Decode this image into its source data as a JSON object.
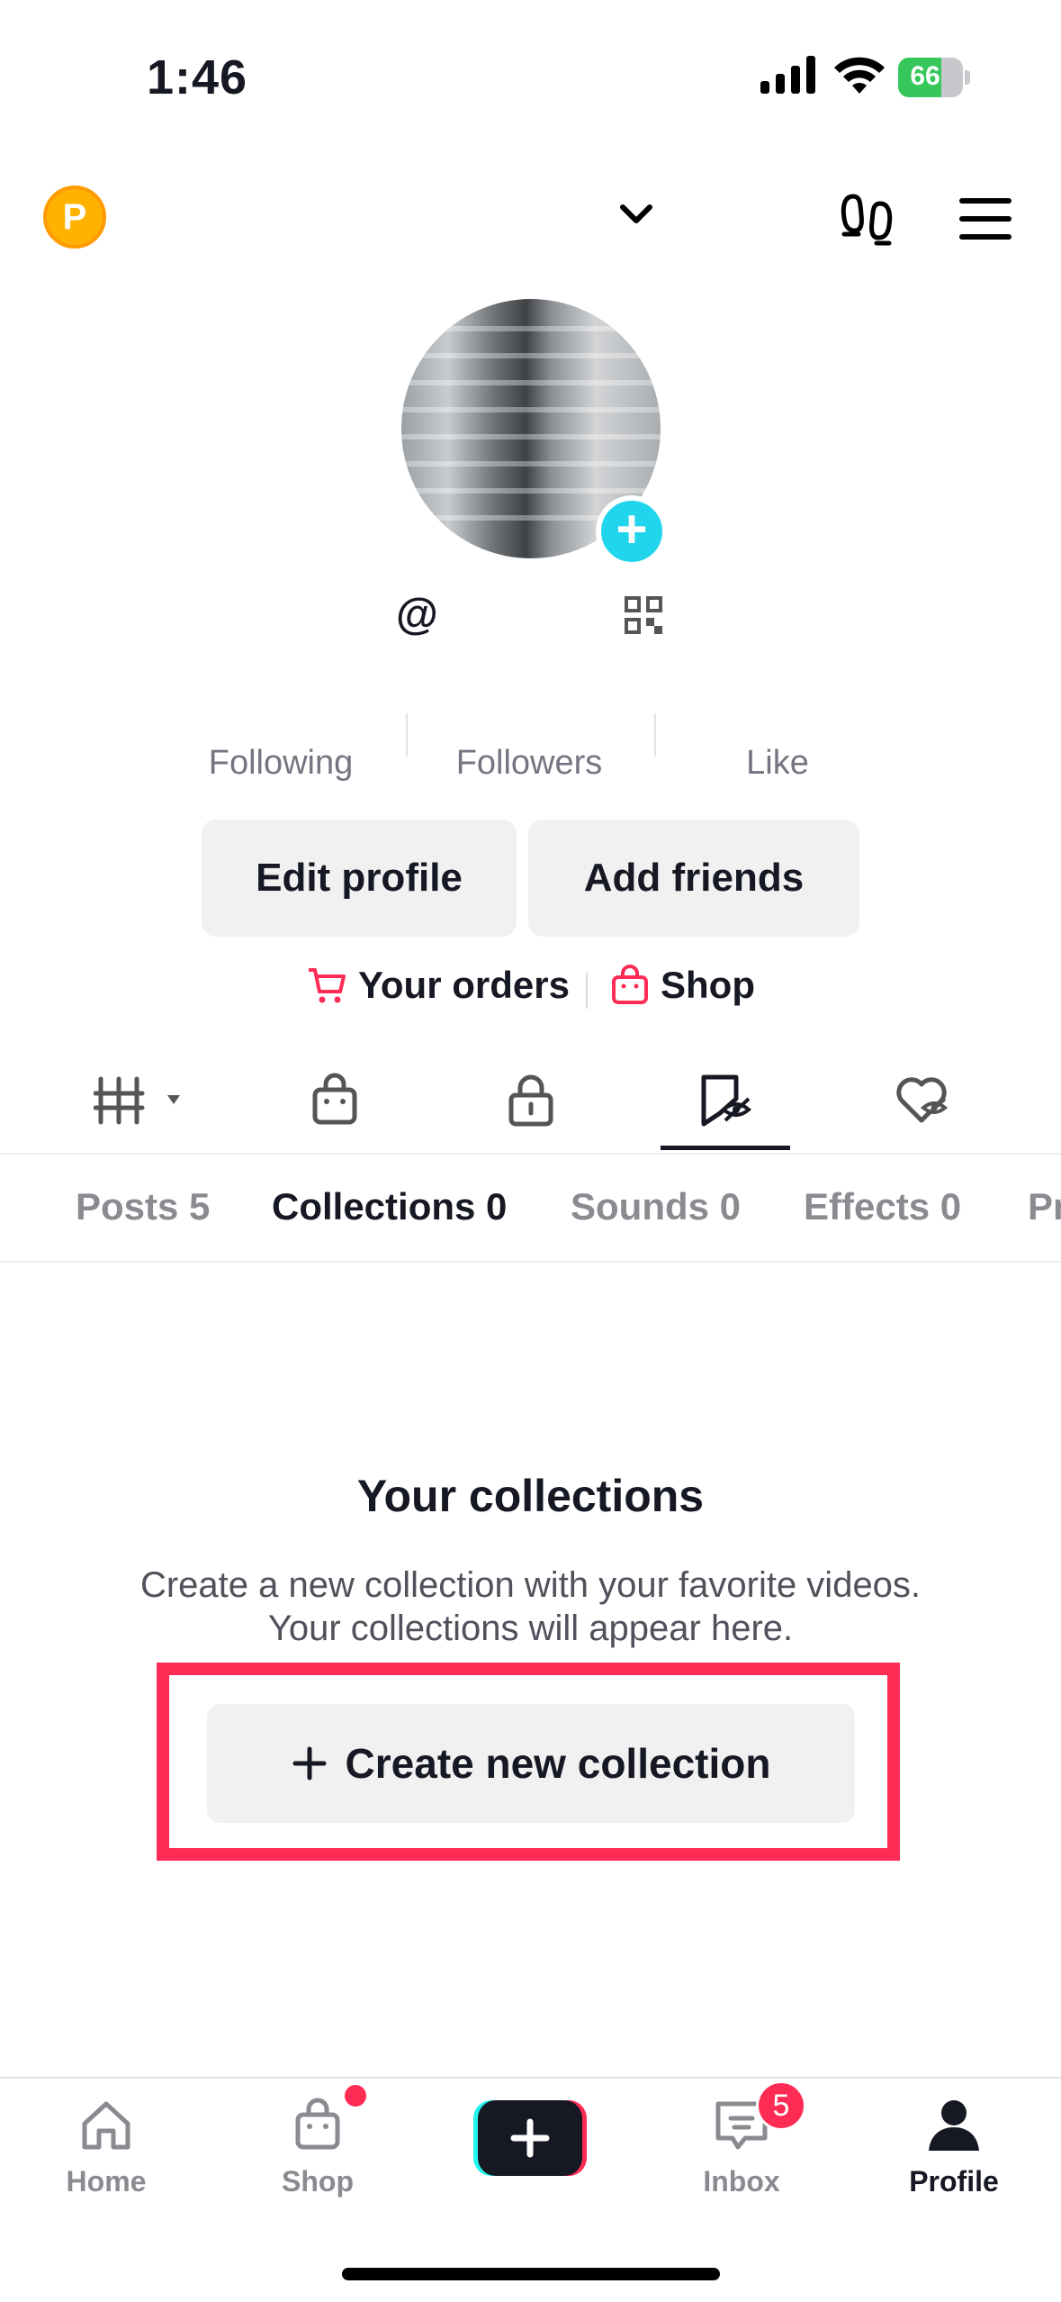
{
  "status_bar": {
    "time": "1:46",
    "battery_level": "66"
  },
  "profile": {
    "at_prefix": "@",
    "stats": [
      {
        "label": "Following"
      },
      {
        "label": "Followers"
      },
      {
        "label": "Like"
      }
    ],
    "edit_profile_label": "Edit profile",
    "add_friends_label": "Add friends",
    "orders_label": "Your orders",
    "shop_label": "Shop"
  },
  "icon_tabs": [
    "grid-dropdown-icon",
    "shop-bag-icon",
    "private-lock-icon",
    "collections-icon",
    "liked-hidden-icon"
  ],
  "sub_tabs": [
    {
      "label": "Posts 5"
    },
    {
      "label": "Collections 0"
    },
    {
      "label": "Sounds 0"
    },
    {
      "label": "Effects 0"
    },
    {
      "label": "Pr"
    }
  ],
  "empty_state": {
    "title": "Your collections",
    "description_line1": "Create a new collection with your favorite videos.",
    "description_line2": "Your collections will appear here.",
    "button_label": "Create new collection"
  },
  "bottom_nav": {
    "home": "Home",
    "shop": "Shop",
    "inbox": "Inbox",
    "inbox_badge": "5",
    "profile": "Profile"
  },
  "colors": {
    "accent": "#fe2c55",
    "cyan": "#20d5ec",
    "text": "#161823"
  }
}
